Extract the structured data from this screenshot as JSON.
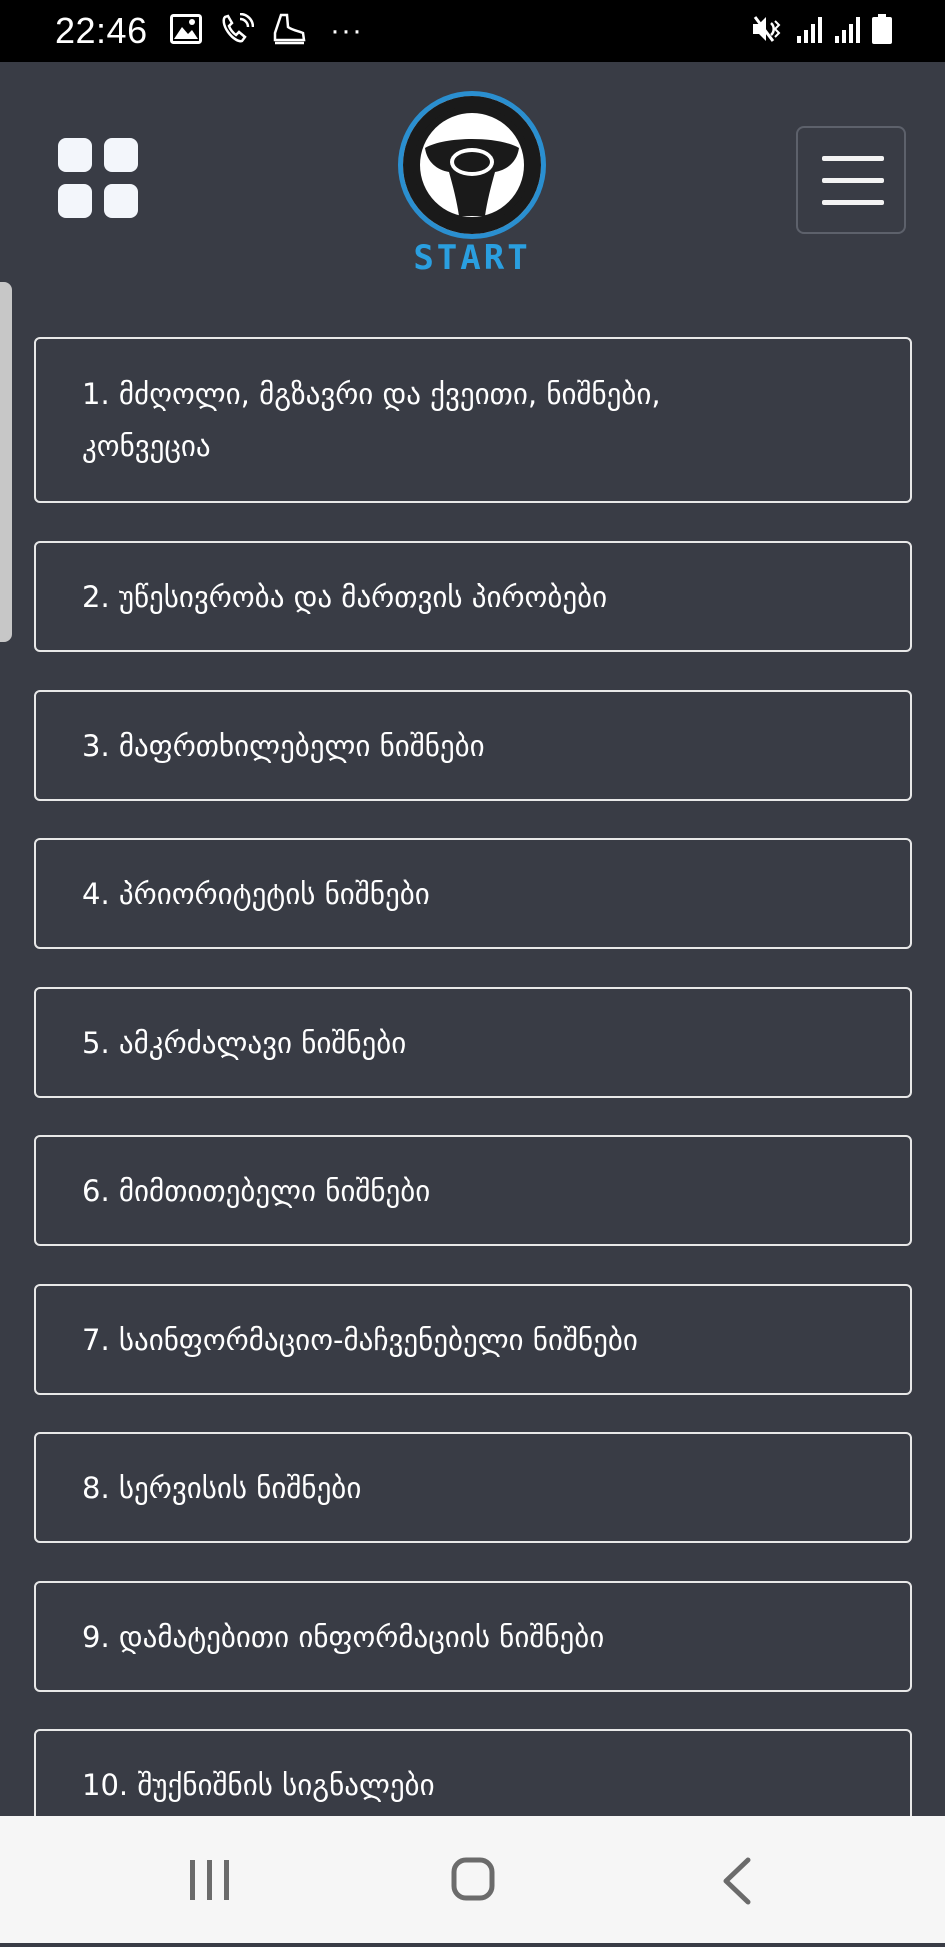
{
  "status_bar": {
    "time": "22:46",
    "more_indicator": "···",
    "icons": [
      "image-icon",
      "wifi-calling-icon",
      "shoe-icon",
      "mute-icon",
      "signal-icon",
      "signal-icon",
      "battery-icon"
    ]
  },
  "header": {
    "logo_text": "START",
    "logo_color": "#2a9fe0",
    "left_icon": "grid-icon",
    "right_icon": "menu-icon"
  },
  "topics": [
    {
      "label_line1": "1. მძღოლი, მგზავრი და ქვეითი, ნიშნები,",
      "label_line2": "კონვეცია"
    },
    {
      "label": "2. უწესივრობა და მართვის პირობები"
    },
    {
      "label": "3. მაფრთხილებელი ნიშნები"
    },
    {
      "label": "4. პრიორიტეტის ნიშნები"
    },
    {
      "label": "5. ამკრძალავი ნიშნები"
    },
    {
      "label": "6. მიმთითებელი ნიშნები"
    },
    {
      "label": "7. საინფორმაციო-მაჩვენებელი ნიშნები"
    },
    {
      "label": "8. სერვისის ნიშნები"
    },
    {
      "label": "9. დამატებითი ინფორმაციის ნიშნები"
    },
    {
      "label": "10. შუქნიშნის სიგნალები"
    }
  ],
  "nav": {
    "recent_icon": "recent-apps-icon",
    "home_icon": "home-icon",
    "back_icon": "back-icon"
  },
  "colors": {
    "background": "#393c45",
    "status_bar": "#000000",
    "nav_bar": "#f6f6f6",
    "card_border": "#e8e8e8"
  }
}
